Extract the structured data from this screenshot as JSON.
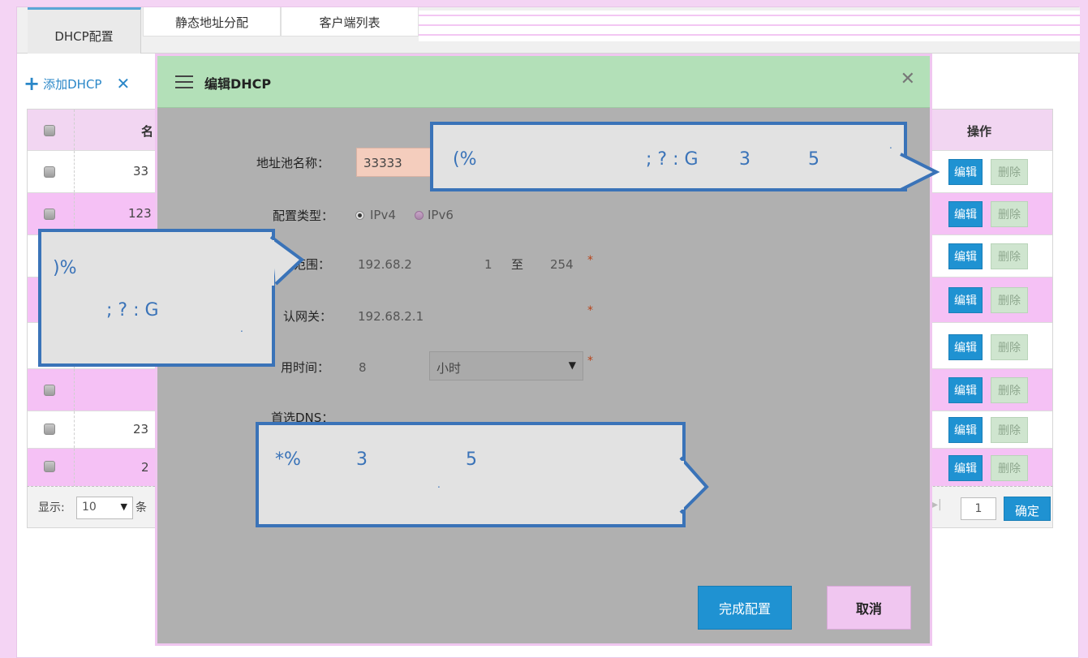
{
  "tabs": [
    {
      "label": "DHCP配置",
      "active": true
    },
    {
      "label": "静态地址分配",
      "active": false
    },
    {
      "label": "客户端列表",
      "active": false
    }
  ],
  "toolbar": {
    "add_label": "添加DHCP",
    "add_icon": "plus-icon",
    "delete_icon": "close-x-icon"
  },
  "table": {
    "header_name": "名",
    "header_ops": "操作",
    "rows": [
      {
        "name": "33",
        "edit": "编辑",
        "del": "删除"
      },
      {
        "name": "123",
        "edit": "编辑",
        "del": "删除"
      },
      {
        "name": "",
        "edit": "编辑",
        "del": "删除"
      },
      {
        "name": "",
        "edit": "编辑",
        "del": "删除"
      },
      {
        "name": "",
        "edit": "编辑",
        "del": "删除"
      },
      {
        "name": "",
        "edit": "编辑",
        "del": "删除"
      },
      {
        "name": "23",
        "edit": "编辑",
        "del": "删除"
      },
      {
        "name": "2",
        "edit": "编辑",
        "del": "删除"
      }
    ]
  },
  "pager": {
    "show_label": "显示:",
    "page_size": "10",
    "unit": "条",
    "page": "1",
    "confirm": "确定"
  },
  "modal": {
    "title": "编辑DHCP",
    "pool_name_label": "地址池名称：",
    "pool_name_value": "33333",
    "config_type_label": "配置类型：",
    "ipv4_label": "IPv4",
    "ipv6_label": "IPv6",
    "range_label": "范围：",
    "range_start": "192.68.2",
    "range_start_last": "1",
    "range_to": "至",
    "range_end": "254",
    "gateway_label": "认网关：",
    "gateway_value": "192.68.2.1",
    "lease_label": "用时间：",
    "lease_value": "8",
    "lease_unit": "小时",
    "dns_label": "首选DNS：",
    "done_button": "完成配置",
    "cancel_button": "取消",
    "required_mark": "*"
  },
  "bubbles": {
    "top": {
      "a": "(%",
      "b": "; ? : G",
      "c": "3",
      "d": "5",
      "e": "."
    },
    "left": {
      "a": ")%",
      "b": "; ? : G",
      "c": "."
    },
    "bottom": {
      "a": "*%",
      "b": "3",
      "c": "5",
      "d": "."
    }
  },
  "colors": {
    "accent": "#1f92d2",
    "pink": "#f5c1f5",
    "green_header": "#b3e0b8",
    "bubble_border": "#3a73b8"
  }
}
